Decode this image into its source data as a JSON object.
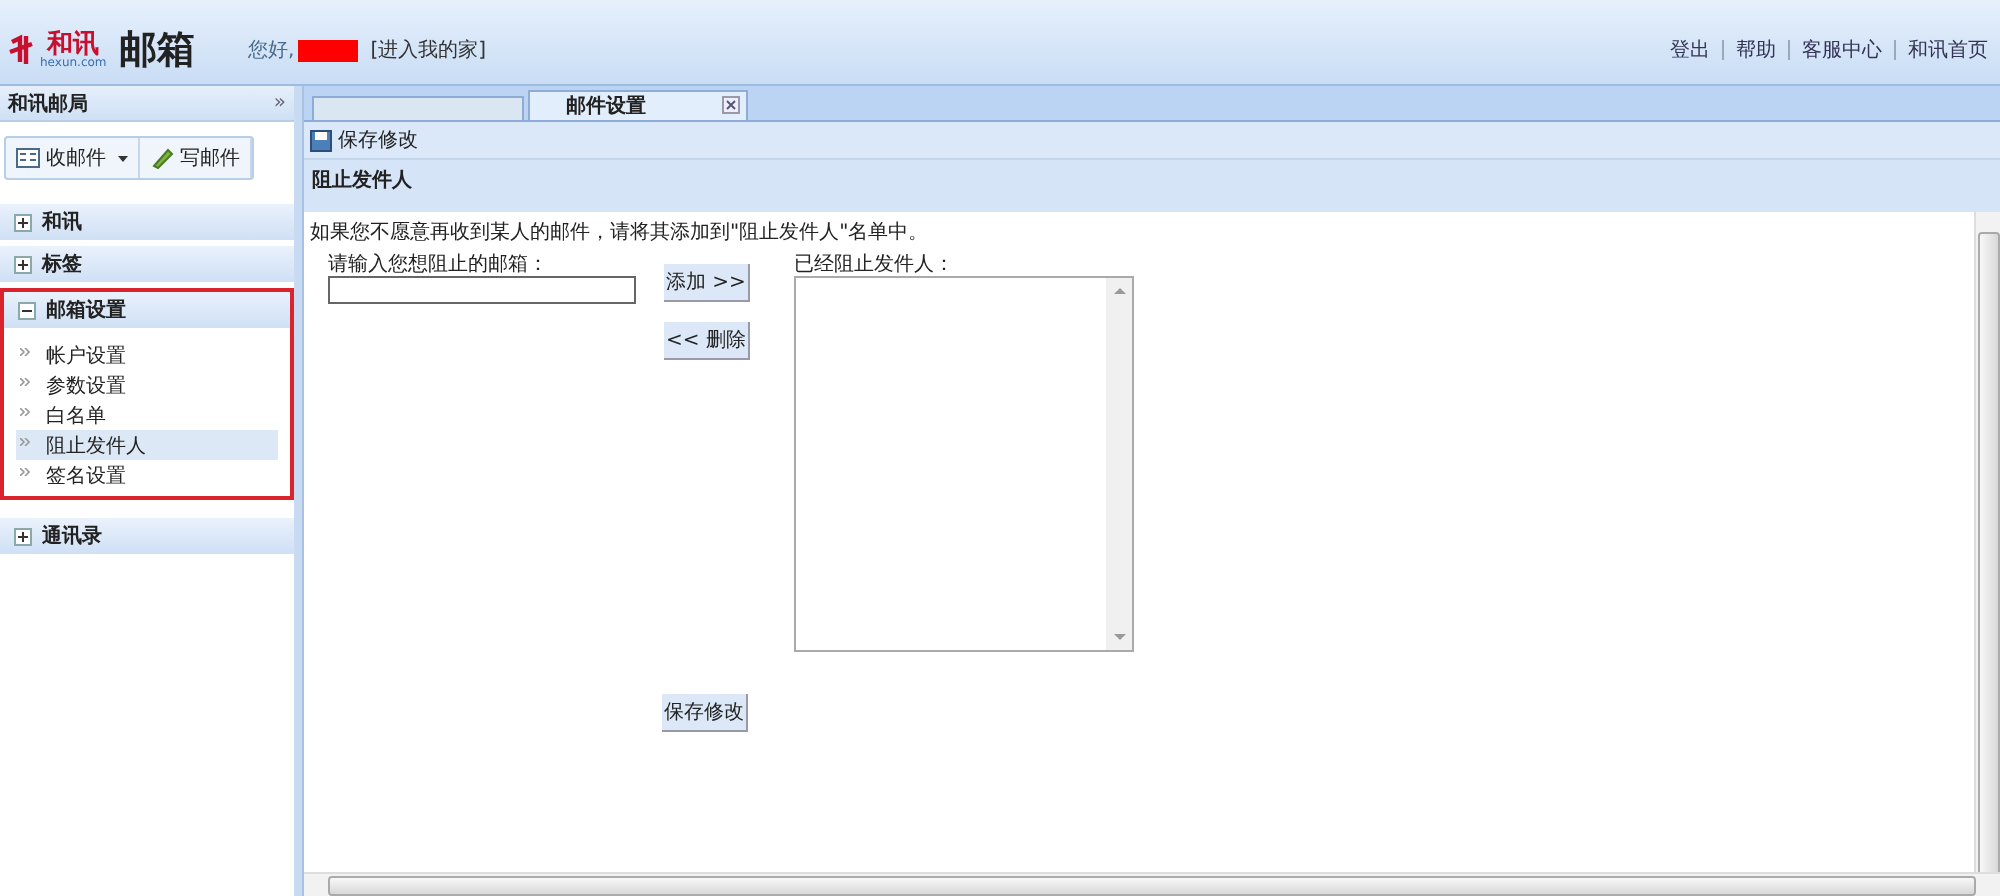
{
  "header": {
    "logo_brand": "和讯",
    "logo_domain": "hexun.com",
    "logo_product": "邮箱",
    "greeting": "您好,",
    "home_link": "[进入我的家]",
    "links": [
      "登出",
      "帮助",
      "客服中心",
      "和讯首页"
    ]
  },
  "sidebar": {
    "title": "和讯邮局",
    "collapse": "»",
    "buttons": [
      {
        "label": "收邮件",
        "kind": "inbox"
      },
      {
        "label": "写邮件",
        "kind": "compose"
      }
    ],
    "sections": [
      {
        "label": "和讯",
        "expanded": false,
        "highlighted": false
      },
      {
        "label": "标签",
        "expanded": false,
        "highlighted": false
      },
      {
        "label": "邮箱设置",
        "expanded": true,
        "highlighted": true,
        "items": [
          {
            "label": "帐户设置",
            "selected": false
          },
          {
            "label": "参数设置",
            "selected": false
          },
          {
            "label": "白名单",
            "selected": false
          },
          {
            "label": "阻止发件人",
            "selected": true
          },
          {
            "label": "签名设置",
            "selected": false
          }
        ]
      },
      {
        "label": "通讯录",
        "expanded": false,
        "highlighted": false
      }
    ]
  },
  "tabs": [
    {
      "selected": false
    },
    {
      "label": "邮件设置",
      "selected": true
    }
  ],
  "toolbar": {
    "save": "保存修改"
  },
  "panel": {
    "title": "阻止发件人",
    "intro": "如果您不愿意再收到某人的邮件，请将其添加到\"阻止发件人\"名单中。",
    "input_label": "请输入您想阻止的邮箱：",
    "add_button": "添加 >>",
    "remove_button": "<< 删除",
    "list_label": "已经阻止发件人：",
    "save_button": "保存修改"
  }
}
